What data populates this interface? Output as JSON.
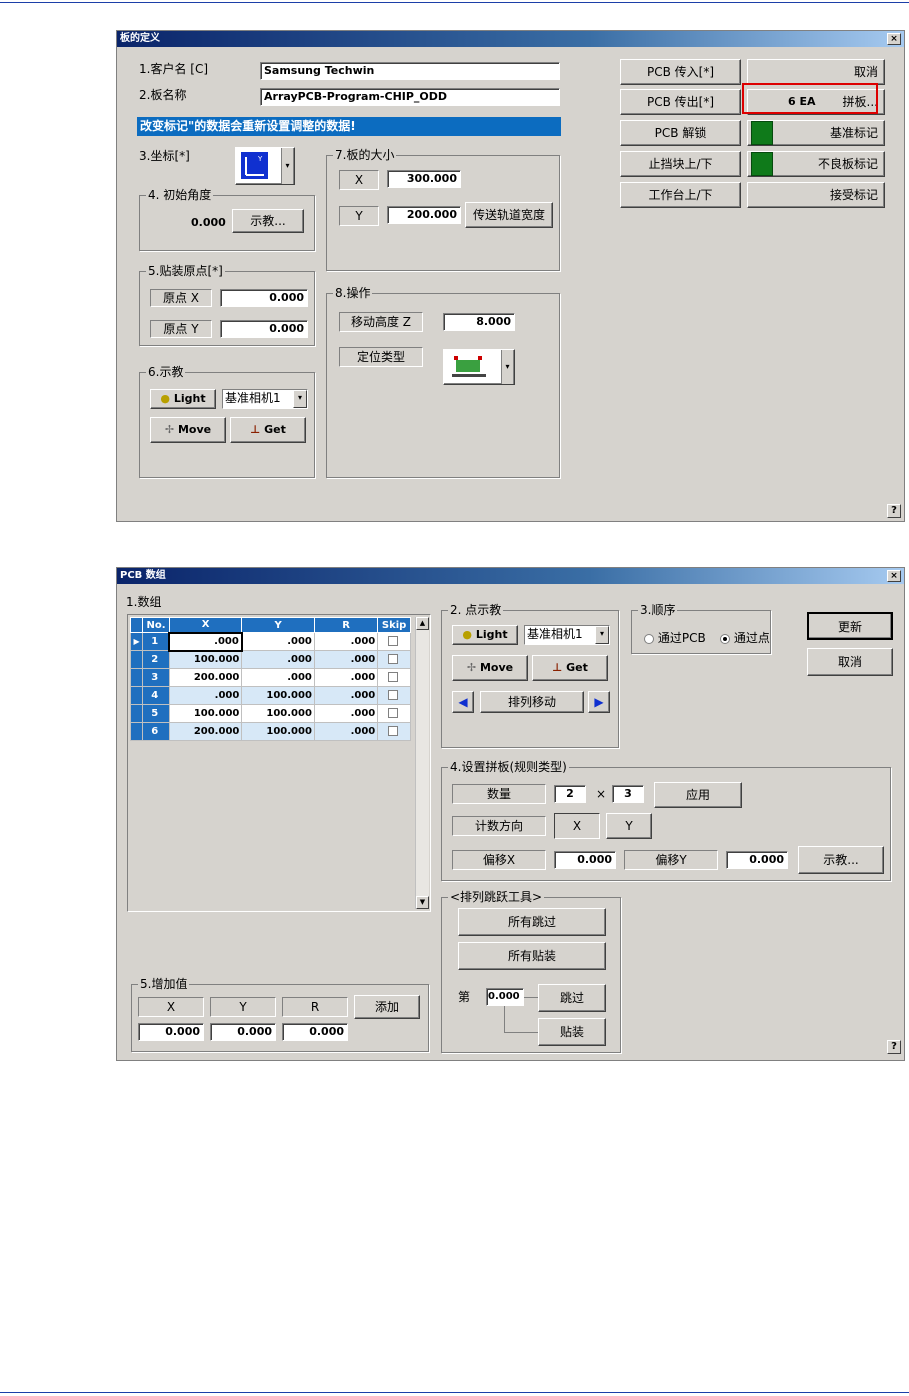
{
  "dialog1": {
    "title": "板的定义",
    "close": "×",
    "customer_label": "1.客户名 [C]",
    "customer_value": "Samsung Techwin",
    "board_label": "2.板名称",
    "board_value": "ArrayPCB-Program-CHIP_ODD",
    "banner": "改变标记\"的数据会重新设置调整的数据!",
    "coord_label": "3.坐标[*]",
    "init_angle": {
      "title": "4. 初始角度",
      "value": "0.000",
      "teach": "示教..."
    },
    "origin": {
      "title": "5.贴装原点[*]",
      "x_label": "原点 X",
      "x_value": "0.000",
      "y_label": "原点 Y",
      "y_value": "0.000"
    },
    "teach": {
      "title": "6.示教",
      "light": "Light",
      "camera": "基准相机1",
      "move": "Move",
      "get": "Get"
    },
    "size": {
      "title": "7.板的大小",
      "x_label": "X",
      "x_value": "300.000",
      "y_label": "Y",
      "y_value": "200.000",
      "rail": "传送轨道宽度"
    },
    "operation": {
      "title": "8.操作",
      "move_z_label": "移动高度 Z",
      "move_z_value": "8.000",
      "locate_label": "定位类型"
    },
    "buttons": {
      "pcb_in": "PCB 传入[*]",
      "cancel": "取消",
      "pcb_out": "PCB 传出[*]",
      "array_count": "6 EA",
      "array": "拼板...",
      "pcb_unlock": "PCB 解锁",
      "fiducial": "基准标记",
      "stopper": "止挡块上/下",
      "bad_mark": "不良板标记",
      "table": "工作台上/下",
      "accept_mark": "接受标记"
    },
    "help": "?"
  },
  "dialog2": {
    "title": "PCB 数组",
    "close": "×",
    "array_title": "1.数组",
    "table": {
      "headers": [
        "No.",
        "X",
        "Y",
        "R",
        "Skip"
      ],
      "rows": [
        [
          "1",
          ".000",
          ".000",
          ".000"
        ],
        [
          "2",
          "100.000",
          ".000",
          ".000"
        ],
        [
          "3",
          "200.000",
          ".000",
          ".000"
        ],
        [
          "4",
          ".000",
          "100.000",
          ".000"
        ],
        [
          "5",
          "100.000",
          "100.000",
          ".000"
        ],
        [
          "6",
          "200.000",
          "100.000",
          ".000"
        ]
      ]
    },
    "point_teach": {
      "title": "2. 点示教",
      "light": "Light",
      "camera": "基准相机1",
      "move": "Move",
      "get": "Get",
      "array_move": "排列移动"
    },
    "order": {
      "title": "3.顺序",
      "by_pcb": "通过PCB",
      "by_point": "通过点"
    },
    "update": "更新",
    "cancel": "取消",
    "set_array": {
      "title": "4.设置拼板(规则类型)",
      "qty_label": "数量",
      "qty_a": "2",
      "times": "×",
      "qty_b": "3",
      "apply": "应用",
      "dir_label": "计数方向",
      "dir_x": "X",
      "dir_y": "Y",
      "offx_label": "偏移X",
      "offx_value": "0.000",
      "offy_label": "偏移Y",
      "offy_value": "0.000",
      "teach": "示教..."
    },
    "skip_tool": {
      "title": "<排列跳跃工具>",
      "skip_all": "所有跳过",
      "place_all": "所有贴装",
      "nth_label": "第",
      "nth_value": "0.000",
      "skip": "跳过",
      "place": "贴装"
    },
    "increment": {
      "title": "5.增加值",
      "x": "X",
      "y": "Y",
      "r": "R",
      "add": "添加",
      "x_value": "0.000",
      "y_value": "0.000",
      "r_value": "0.000"
    },
    "help": "?"
  }
}
